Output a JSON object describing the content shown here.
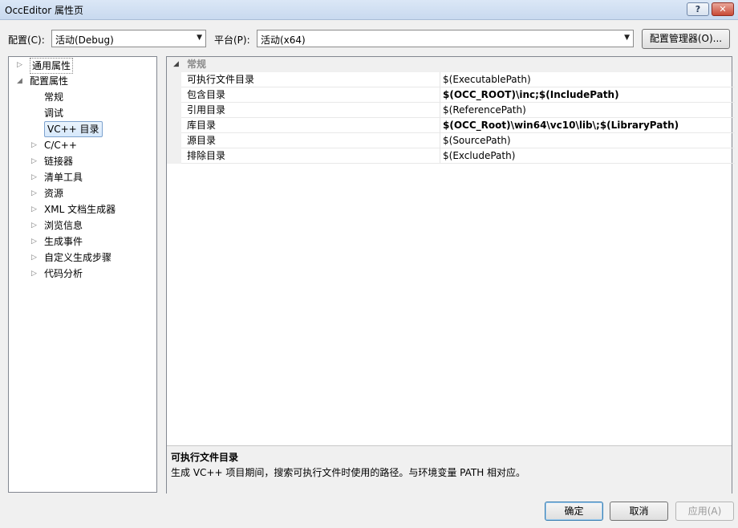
{
  "window": {
    "title": "OccEditor 属性页",
    "help_glyph": "?",
    "close_glyph": "✕"
  },
  "toolbar": {
    "config_label": "配置(C):",
    "config_value": "活动(Debug)",
    "platform_label": "平台(P):",
    "platform_value": "活动(x64)",
    "config_manager_label": "配置管理器(O)..."
  },
  "tree": {
    "common_props": "通用属性",
    "config_props": "配置属性",
    "items": [
      {
        "label": "常规",
        "expandable": false
      },
      {
        "label": "调试",
        "expandable": false
      },
      {
        "label": "VC++ 目录",
        "expandable": false,
        "selected": true
      },
      {
        "label": "C/C++",
        "expandable": true
      },
      {
        "label": "链接器",
        "expandable": true
      },
      {
        "label": "清单工具",
        "expandable": true
      },
      {
        "label": "资源",
        "expandable": true
      },
      {
        "label": "XML 文档生成器",
        "expandable": true
      },
      {
        "label": "浏览信息",
        "expandable": true
      },
      {
        "label": "生成事件",
        "expandable": true
      },
      {
        "label": "自定义生成步骤",
        "expandable": true
      },
      {
        "label": "代码分析",
        "expandable": true
      }
    ]
  },
  "grid": {
    "category": "常规",
    "rows": [
      {
        "name": "可执行文件目录",
        "value": "$(ExecutablePath)",
        "bold": false
      },
      {
        "name": "包含目录",
        "value": "$(OCC_ROOT)\\inc;$(IncludePath)",
        "bold": true
      },
      {
        "name": "引用目录",
        "value": "$(ReferencePath)",
        "bold": false
      },
      {
        "name": "库目录",
        "value": "$(OCC_Root)\\win64\\vc10\\lib\\;$(LibraryPath)",
        "bold": true
      },
      {
        "name": "源目录",
        "value": "$(SourcePath)",
        "bold": false
      },
      {
        "name": "排除目录",
        "value": "$(ExcludePath)",
        "bold": false
      }
    ]
  },
  "description": {
    "title": "可执行文件目录",
    "text": "生成 VC++ 项目期间，搜索可执行文件时使用的路径。与环境变量 PATH 相对应。"
  },
  "buttons": {
    "ok": "确定",
    "cancel": "取消",
    "apply": "应用(A)"
  },
  "icons": {
    "expand_collapsed": "▷",
    "expand_open": "◢",
    "dropdown": "▼"
  }
}
